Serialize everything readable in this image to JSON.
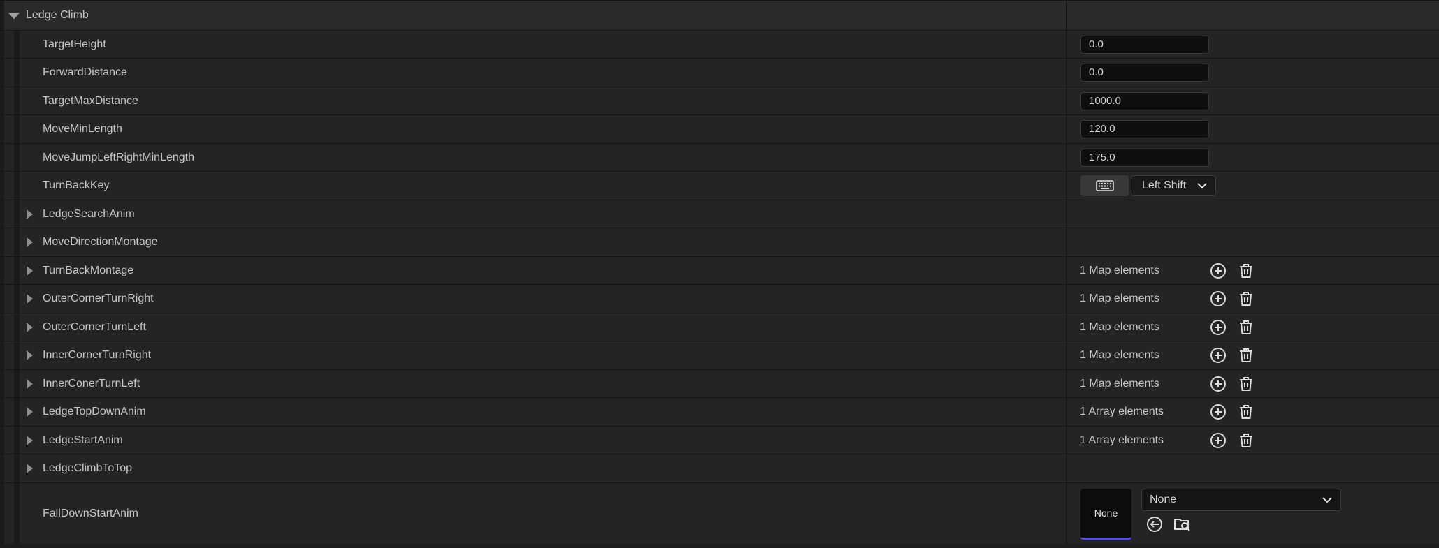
{
  "section": {
    "title": "Ledge Climb"
  },
  "rows": {
    "target_height": {
      "label": "TargetHeight",
      "value": "0.0"
    },
    "forward_distance": {
      "label": "ForwardDistance",
      "value": "0.0"
    },
    "target_max_distance": {
      "label": "TargetMaxDistance",
      "value": "1000.0"
    },
    "move_min_length": {
      "label": "MoveMinLength",
      "value": "120.0"
    },
    "move_jump_lr_min_length": {
      "label": "MoveJumpLeftRightMinLength",
      "value": "175.0"
    },
    "turn_back_key": {
      "label": "TurnBackKey",
      "key": "Left Shift",
      "key_icon": "keyboard-icon"
    },
    "ledge_search_anim": {
      "label": "LedgeSearchAnim"
    },
    "move_direction_montage": {
      "label": "MoveDirectionMontage"
    },
    "turn_back_montage": {
      "label": "TurnBackMontage",
      "count": "1 Map elements"
    },
    "outer_corner_turn_right": {
      "label": "OuterCornerTurnRight",
      "count": "1 Map elements"
    },
    "outer_corner_turn_left": {
      "label": "OuterCornerTurnLeft",
      "count": "1 Map elements"
    },
    "inner_corner_turn_right": {
      "label": "InnerCornerTurnRight",
      "count": "1 Map elements"
    },
    "inner_coner_turn_left": {
      "label": "InnerConerTurnLeft",
      "count": "1 Map elements"
    },
    "ledge_top_down_anim": {
      "label": "LedgeTopDownAnim",
      "count": "1 Array elements"
    },
    "ledge_start_anim": {
      "label": "LedgeStartAnim",
      "count": "1 Array elements"
    },
    "ledge_climb_to_top": {
      "label": "LedgeClimbToTop"
    },
    "fall_down_start_anim": {
      "label": "FallDownStartAnim",
      "thumbnail": "None",
      "asset": "None"
    }
  },
  "icons": {
    "expand": "triangle-right-icon",
    "collapse": "triangle-down-icon",
    "add": "plus-circle-icon",
    "delete": "trash-icon",
    "use_selected": "arrow-left-circle-icon",
    "browse": "folder-search-icon",
    "dropdown": "chevron-down-icon"
  },
  "colors": {
    "row_bg": "#242424",
    "header_bg": "#2a2a2a",
    "input_bg": "#0f0f0f",
    "text": "#c6c6c6",
    "thumb_accent": "#5a4fd3"
  }
}
